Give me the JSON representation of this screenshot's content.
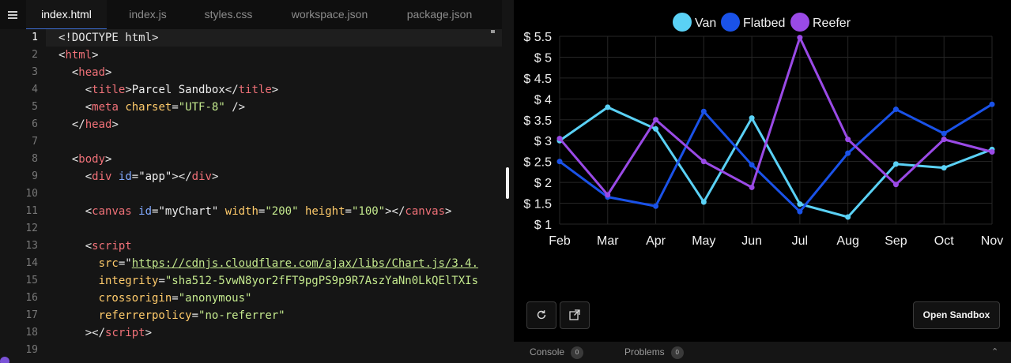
{
  "editor": {
    "tabs": [
      {
        "label": "index.html",
        "active": true
      },
      {
        "label": "index.js",
        "active": false
      },
      {
        "label": "styles.css",
        "active": false
      },
      {
        "label": "workspace.json",
        "active": false
      },
      {
        "label": "package.json",
        "active": false
      }
    ],
    "current_line": 1,
    "lines": [
      [
        [
          "punc",
          "<!DOCTYPE html>"
        ]
      ],
      [
        [
          "punc",
          "<"
        ],
        [
          "tag",
          "html"
        ],
        [
          "punc",
          ">"
        ]
      ],
      [
        [
          "txt",
          "  "
        ],
        [
          "punc",
          "<"
        ],
        [
          "tag",
          "head"
        ],
        [
          "punc",
          ">"
        ]
      ],
      [
        [
          "txt",
          "    "
        ],
        [
          "punc",
          "<"
        ],
        [
          "tag",
          "title"
        ],
        [
          "punc",
          ">"
        ],
        [
          "txt",
          "Parcel Sandbox"
        ],
        [
          "punc",
          "</"
        ],
        [
          "tag",
          "title"
        ],
        [
          "punc",
          ">"
        ]
      ],
      [
        [
          "txt",
          "    "
        ],
        [
          "punc",
          "<"
        ],
        [
          "tag",
          "meta"
        ],
        [
          "txt",
          " "
        ],
        [
          "attr",
          "charset"
        ],
        [
          "punc",
          "="
        ],
        [
          "str",
          "\"UTF-8\""
        ],
        [
          "txt",
          " "
        ],
        [
          "punc",
          "/>"
        ]
      ],
      [
        [
          "txt",
          "  "
        ],
        [
          "punc",
          "</"
        ],
        [
          "tag",
          "head"
        ],
        [
          "punc",
          ">"
        ]
      ],
      [],
      [
        [
          "txt",
          "  "
        ],
        [
          "punc",
          "<"
        ],
        [
          "tag",
          "body"
        ],
        [
          "punc",
          ">"
        ]
      ],
      [
        [
          "txt",
          "    "
        ],
        [
          "punc",
          "<"
        ],
        [
          "tag",
          "div"
        ],
        [
          "txt",
          " "
        ],
        [
          "attr2",
          "id"
        ],
        [
          "punc",
          "="
        ],
        [
          "str2",
          "\"app\""
        ],
        [
          "punc",
          "></"
        ],
        [
          "tag",
          "div"
        ],
        [
          "punc",
          ">"
        ]
      ],
      [],
      [
        [
          "txt",
          "    "
        ],
        [
          "punc",
          "<"
        ],
        [
          "tag",
          "canvas"
        ],
        [
          "txt",
          " "
        ],
        [
          "attr2",
          "id"
        ],
        [
          "punc",
          "="
        ],
        [
          "str2",
          "\"myChart\""
        ],
        [
          "txt",
          " "
        ],
        [
          "attr",
          "width"
        ],
        [
          "punc",
          "="
        ],
        [
          "str",
          "\"200\""
        ],
        [
          "txt",
          " "
        ],
        [
          "attr",
          "height"
        ],
        [
          "punc",
          "="
        ],
        [
          "str",
          "\"100\""
        ],
        [
          "punc",
          "></"
        ],
        [
          "tag",
          "canvas"
        ],
        [
          "punc",
          ">"
        ]
      ],
      [],
      [
        [
          "txt",
          "    "
        ],
        [
          "punc",
          "<"
        ],
        [
          "tag",
          "script"
        ]
      ],
      [
        [
          "txt",
          "      "
        ],
        [
          "attr",
          "src"
        ],
        [
          "punc",
          "=\""
        ],
        [
          "url",
          "https://cdnjs.cloudflare.com/ajax/libs/Chart.js/3.4."
        ]
      ],
      [
        [
          "txt",
          "      "
        ],
        [
          "attr",
          "integrity"
        ],
        [
          "punc",
          "="
        ],
        [
          "str",
          "\"sha512-5vwN8yor2fFT9pgPS9p9R7AszYaNn0LkQElTXIs"
        ]
      ],
      [
        [
          "txt",
          "      "
        ],
        [
          "attr",
          "crossorigin"
        ],
        [
          "punc",
          "="
        ],
        [
          "str",
          "\"anonymous\""
        ]
      ],
      [
        [
          "txt",
          "      "
        ],
        [
          "attr",
          "referrerpolicy"
        ],
        [
          "punc",
          "="
        ],
        [
          "str",
          "\"no-referrer\""
        ]
      ],
      [
        [
          "txt",
          "    "
        ],
        [
          "punc",
          "></"
        ],
        [
          "tag",
          "script"
        ],
        [
          "punc",
          ">"
        ]
      ],
      []
    ]
  },
  "preview": {
    "refresh_icon": "refresh-icon",
    "open_new_window_icon": "external-link-icon",
    "open_sandbox_label": "Open Sandbox",
    "console": {
      "label": "Console",
      "count": "0"
    },
    "problems": {
      "label": "Problems",
      "count": "0"
    }
  },
  "chart_data": {
    "type": "line",
    "categories": [
      "Feb",
      "Mar",
      "Apr",
      "May",
      "Jun",
      "Jul",
      "Aug",
      "Sep",
      "Oct",
      "Nov"
    ],
    "series": [
      {
        "name": "Van",
        "color": "#5ad1f5",
        "values": [
          3.0,
          3.8,
          3.28,
          1.53,
          3.54,
          1.48,
          1.17,
          2.44,
          2.35,
          2.79
        ]
      },
      {
        "name": "Flatbed",
        "color": "#1a52e8",
        "values": [
          2.5,
          1.65,
          1.43,
          3.7,
          2.42,
          1.3,
          2.7,
          3.75,
          3.17,
          3.87
        ]
      },
      {
        "name": "Reefer",
        "color": "#9a4ae6",
        "values": [
          3.05,
          1.7,
          3.5,
          2.5,
          1.88,
          5.47,
          3.03,
          1.95,
          3.03,
          2.73
        ]
      }
    ],
    "ylim": [
      1,
      5.5
    ],
    "yticks": [
      "$ 1",
      "$ 1.5",
      "$ 2",
      "$ 2.5",
      "$ 3",
      "$ 3.5",
      "$ 4",
      "$ 4.5",
      "$ 5",
      "$ 5.5"
    ],
    "ytick_values": [
      1,
      1.5,
      2,
      2.5,
      3,
      3.5,
      4,
      4.5,
      5,
      5.5
    ],
    "legend": "top-center",
    "grid": true
  }
}
